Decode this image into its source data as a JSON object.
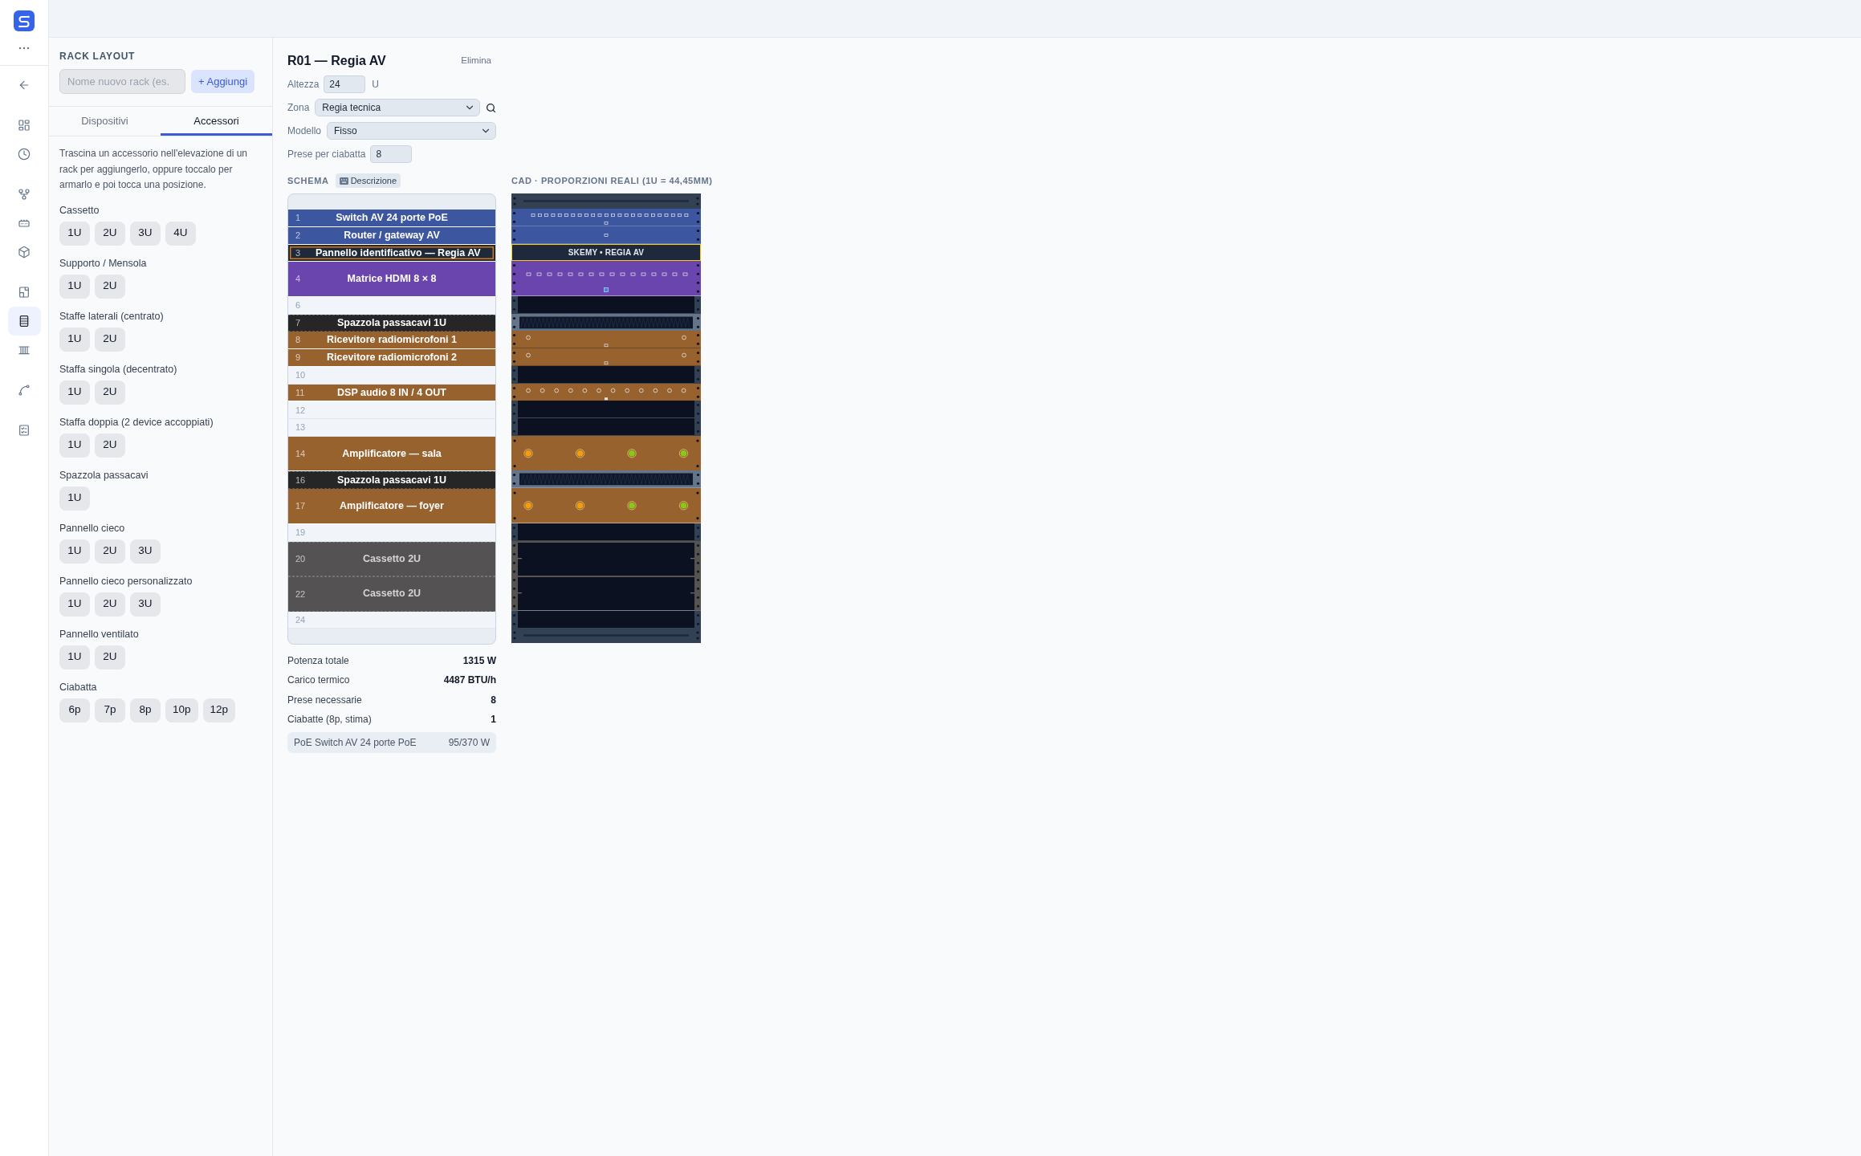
{
  "nav": [
    [
      {
        "selected": false
      }
    ],
    [
      {
        "selected": false
      },
      {
        "selected": false
      }
    ],
    [
      {
        "selected": false
      },
      {
        "selected": false
      },
      {
        "selected": false
      }
    ],
    [
      {
        "selected": false
      },
      {
        "selected": true
      },
      {
        "selected": false
      }
    ],
    [
      {
        "selected": false
      }
    ],
    [
      {
        "selected": false
      }
    ]
  ],
  "sidebar": {
    "title": "RACK LAYOUT",
    "new_rack": {
      "placeholder": "Nome nuovo rack (es."
    },
    "add_button": "+ Aggiungi",
    "tabs": [
      {
        "label": "Dispositivi",
        "selected": false
      },
      {
        "label": "Accessori",
        "selected": true
      }
    ],
    "hint": "Trascina un accessorio nell'elevazione di un rack per aggiungerlo, oppure toccalo per armarlo e poi tocca una posizione.",
    "groups": [
      {
        "title": "Cassetto",
        "sizes": [
          "1U",
          "2U",
          "3U",
          "4U"
        ]
      },
      {
        "title": "Supporto / Mensola",
        "sizes": [
          "1U",
          "2U"
        ]
      },
      {
        "title": "Staffe laterali (centrato)",
        "sizes": [
          "1U",
          "2U"
        ]
      },
      {
        "title": "Staffa singola (decentrato)",
        "sizes": [
          "1U",
          "2U"
        ]
      },
      {
        "title": "Staffa doppia (2 device accoppiati)",
        "sizes": [
          "1U",
          "2U"
        ]
      },
      {
        "title": "Spazzola passacavi",
        "sizes": [
          "1U"
        ]
      },
      {
        "title": "Pannello cieco",
        "sizes": [
          "1U",
          "2U",
          "3U"
        ]
      },
      {
        "title": "Pannello cieco personalizzato",
        "sizes": [
          "1U",
          "2U",
          "3U"
        ]
      },
      {
        "title": "Pannello ventilato",
        "sizes": [
          "1U",
          "2U"
        ]
      },
      {
        "title": "Ciabatta",
        "sizes": [
          "6p",
          "7p",
          "8p",
          "10p",
          "12p"
        ]
      }
    ]
  },
  "rack": {
    "title": "R01 — Regia AV",
    "delete": "Elimina",
    "fields": [
      {
        "kind": "number",
        "label": "Altezza",
        "value": "24",
        "unit": "U"
      },
      {
        "kind": "select",
        "label": "Zona",
        "value": "Regia tecnica",
        "search": true
      },
      {
        "kind": "select",
        "label": "Modello",
        "value": "Fisso"
      },
      {
        "kind": "number",
        "label": "Prese per ciabatta",
        "value": "8"
      }
    ],
    "schema": {
      "title": "SCHEMA",
      "description_button": "Descrizione"
    },
    "cad": {
      "title": "CAD · PROPORZIONI REALI (1U = 44,45MM)"
    },
    "units": [
      {
        "u": "1",
        "kind": "switch",
        "name": "Switch AV 24 porte PoE",
        "color": "#3d56a0",
        "tall": false,
        "selected": false
      },
      {
        "u": "2",
        "kind": "router",
        "name": "Router / gateway AV",
        "color": "#3d56a0",
        "tall": false,
        "selected": false
      },
      {
        "u": "3",
        "kind": "label",
        "name": "Pannello identificativo — Regia AV",
        "plate": "SKEMY • REGIA AV",
        "color": "#1e293b",
        "tall": false,
        "selected": true
      },
      {
        "u": "4",
        "kind": "matrix",
        "name": "Matrice HDMI 8 × 8",
        "color": "#6a45ad",
        "tall": true,
        "selected": false
      },
      {
        "u": "6",
        "kind": "empty",
        "selected": false
      },
      {
        "u": "7",
        "kind": "brush",
        "name": "Spazzola passacavi 1U",
        "color": "#262626",
        "tall": false,
        "selected": false
      },
      {
        "u": "8",
        "kind": "receiver",
        "name": "Ricevitore radiomicrofoni 1",
        "color": "#98622f",
        "tall": false,
        "selected": false
      },
      {
        "u": "9",
        "kind": "receiver",
        "name": "Ricevitore radiomicrofoni 2",
        "color": "#98622f",
        "tall": false,
        "selected": false
      },
      {
        "u": "10",
        "kind": "empty",
        "selected": false
      },
      {
        "u": "11",
        "kind": "dsp",
        "name": "DSP audio 8 IN / 4 OUT",
        "color": "#98622f",
        "tall": false,
        "selected": false
      },
      {
        "u": "12",
        "kind": "empty",
        "selected": false
      },
      {
        "u": "13",
        "kind": "empty",
        "selected": false
      },
      {
        "u": "14",
        "kind": "amplifier",
        "name": "Amplificatore — sala",
        "color": "#98622f",
        "tall": true,
        "selected": false
      },
      {
        "u": "16",
        "kind": "brush",
        "name": "Spazzola passacavi 1U",
        "color": "#262626",
        "tall": false,
        "selected": false
      },
      {
        "u": "17",
        "kind": "amplifier",
        "name": "Amplificatore — foyer",
        "color": "#98622f",
        "tall": true,
        "selected": false
      },
      {
        "u": "19",
        "kind": "empty",
        "selected": false
      },
      {
        "u": "20",
        "kind": "drawer",
        "name": "Cassetto 2U",
        "color": "#545252",
        "tall": true,
        "selected": false
      },
      {
        "u": "22",
        "kind": "drawer",
        "name": "Cassetto 2U",
        "color": "#545252",
        "tall": true,
        "selected": false
      },
      {
        "u": "24",
        "kind": "empty",
        "selected": false
      }
    ],
    "stats": [
      {
        "label": "Potenza totale",
        "value": "1315 W"
      },
      {
        "label": "Carico termico",
        "value": "4487 BTU/h"
      },
      {
        "label": "Prese necessarie",
        "value": "8"
      },
      {
        "label": "Ciabatte (8p, stima)",
        "value": "1"
      }
    ],
    "poe": {
      "label": "PoE Switch AV 24 porte PoE",
      "value": "95/370 W"
    }
  }
}
